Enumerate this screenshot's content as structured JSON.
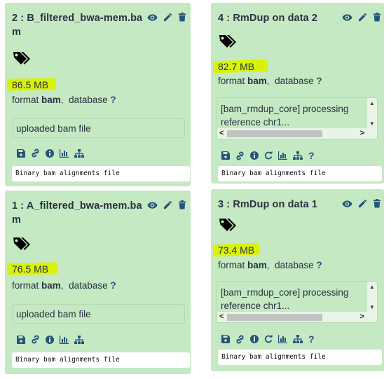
{
  "colors": {
    "card_bg": "#c5e9c2",
    "highlight": "#d9f20a",
    "icon_color": "#25537b"
  },
  "datasets": [
    {
      "title": "2 : B_filtered_bwa-mem.bam",
      "size": "86.5 MB",
      "format_label": "format",
      "format": "bam",
      "database_label": "database",
      "database": "?",
      "info": "uploaded bam file",
      "blurb": "Binary bam alignments file"
    },
    {
      "title": "1 : A_filtered_bwa-mem.bam",
      "size": "76.5 MB",
      "format_label": "format",
      "format": "bam",
      "database_label": "database",
      "database": "?",
      "info": "uploaded bam file",
      "blurb": "Binary bam alignments file"
    },
    {
      "title": "4 : RmDup on data 2",
      "size": "82.7 MB",
      "format_label": "format",
      "format": "bam",
      "database_label": "database",
      "database": "?",
      "peek_line1": "[bam_rmdup_core] processing",
      "peek_line2": "reference chr1...",
      "blurb": "Binary bam alignments file"
    },
    {
      "title": "3 : RmDup on data 1",
      "size": "73.4 MB",
      "format_label": "format",
      "format": "bam",
      "database_label": "database",
      "database": "?",
      "peek_line1": "[bam_rmdup_core] processing",
      "peek_line2": "reference chr1...",
      "blurb": "Binary bam alignments file"
    }
  ],
  "icons": {
    "header": [
      "eye-icon",
      "pencil-icon",
      "trash-icon"
    ],
    "tags": "tags-icon",
    "actions_upload": [
      "save-icon",
      "link-icon",
      "info-icon",
      "chart-icon",
      "sitemap-icon"
    ],
    "actions_rmdup": [
      "save-icon",
      "link-icon",
      "info-icon",
      "rerun-icon",
      "chart-icon",
      "sitemap-icon",
      "help-icon"
    ],
    "help_glyph": "?"
  }
}
